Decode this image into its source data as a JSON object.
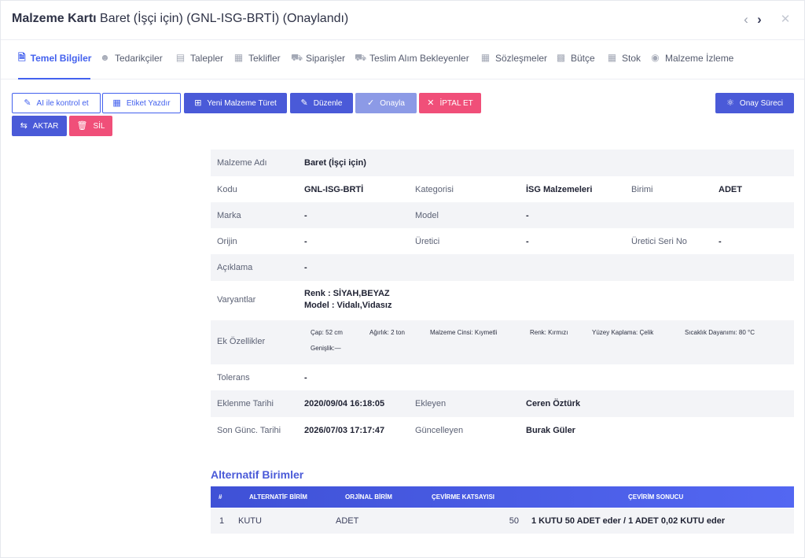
{
  "header": {
    "title_bold": "Malzeme Kartı",
    "title_rest": "Baret (İşçi için) (GNL-ISG-BRTİ) (Onaylandı)",
    "prev_icon": "chevron-left-icon",
    "next_icon": "chevron-right-icon",
    "close_icon": "close-icon"
  },
  "tabs": [
    {
      "label": "Temel Bilgiler",
      "icon": "document-icon",
      "active": true
    },
    {
      "label": "Tedarikçiler",
      "icon": "users-icon"
    },
    {
      "label": "Talepler",
      "icon": "file-icon"
    },
    {
      "label": "Teklifler",
      "icon": "calendar-icon"
    },
    {
      "label": "Siparişler",
      "icon": "cart-icon"
    },
    {
      "label": "Teslim Alım Bekleyenler",
      "icon": "truck-icon"
    },
    {
      "label": "Sözleşmeler",
      "icon": "calendar-icon"
    },
    {
      "label": "Bütçe",
      "icon": "money-icon"
    },
    {
      "label": "Stok",
      "icon": "calendar-icon"
    },
    {
      "label": "Malzeme İzleme",
      "icon": "binoculars-icon"
    }
  ],
  "actions": {
    "ai_check": "AI ile kontrol et",
    "print_label": "Etiket Yazdır",
    "new_material": "Yeni Malzeme Türet",
    "edit": "Düzenle",
    "approve": "Onayla",
    "cancel": "İPTAL ET",
    "approval_process": "Onay Süreci",
    "transfer": "AKTAR",
    "delete": "SİL"
  },
  "info": {
    "name_label": "Malzeme Adı",
    "name": "Baret (İşçi için)",
    "code_label": "Kodu",
    "code": "GNL-ISG-BRTİ",
    "category_label": "Kategorisi",
    "category": "İSG Malzemeleri",
    "unit_label": "Birimi",
    "unit": "ADET",
    "brand_label": "Marka",
    "brand": "-",
    "model_label": "Model",
    "model": "-",
    "origin_label": "Orijin",
    "origin": "-",
    "producer_label": "Üretici",
    "producer": "-",
    "serial_label": "Üretici Seri No",
    "serial": "-",
    "desc_label": "Açıklama",
    "desc": "-",
    "variants_label": "Varyantlar",
    "variant1": "Renk : SİYAH,BEYAZ",
    "variant2": "Model : Vidalı,Vidasız",
    "extra_label": "Ek Özellikler",
    "extra": [
      "Çap: 52 cm",
      "Ağırlık: 2 ton",
      "Malzeme Cinsi: Kıymetli",
      "Renk: Kırmızı",
      "Yüzey Kaplama: Çelik",
      "Sıcaklık Dayanımı: 80 °C",
      "Genişlik:—"
    ],
    "tolerance_label": "Tolerans",
    "tolerance": "-",
    "added_label": "Eklenme Tarihi",
    "added": "2020/09/04 16:18:05",
    "adder_label": "Ekleyen",
    "adder": "Ceren Öztürk",
    "updated_label": "Son Günc. Tarihi",
    "updated": "2026/07/03 17:17:47",
    "updater_label": "Güncelleyen",
    "updater": "Burak Güler"
  },
  "alt_units": {
    "title": "Alternatif Birimler",
    "headers": [
      "#",
      "ALTERNATİF BİRİM",
      "ORJİNAL BİRİM",
      "ÇEVİRME KATSAYISI",
      "ÇEVİRİM SONUCU"
    ],
    "rows": [
      {
        "no": "1",
        "alt": "KUTU",
        "orig": "ADET",
        "coef": "50",
        "result": "1 KUTU 50 ADET eder / 1 ADET 0,02 KUTU eder"
      }
    ]
  },
  "colors": {
    "primary": "#4a5ad8",
    "accent": "#4361ee",
    "danger": "#f04f79",
    "disabled": "#8c9ae6"
  }
}
